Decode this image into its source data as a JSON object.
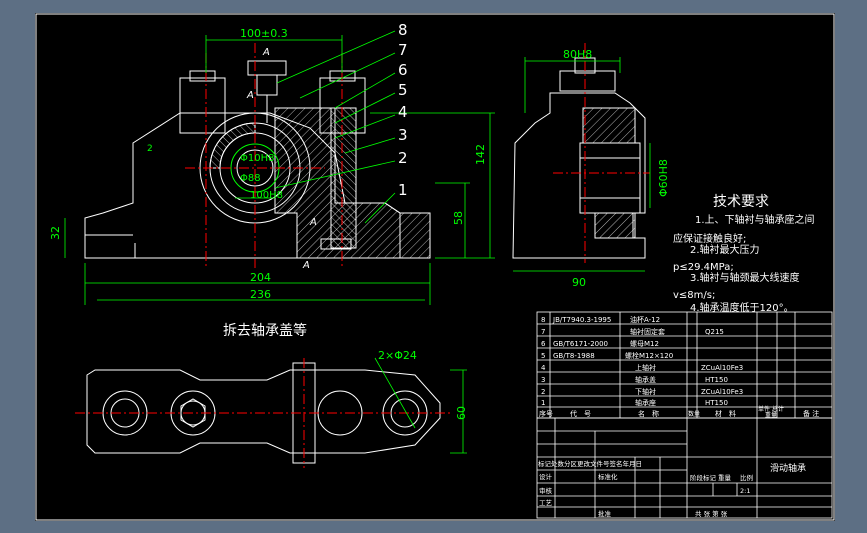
{
  "drawing": {
    "top_dimension": "100±0.3",
    "section_marks": [
      "A",
      "A",
      "A",
      "A"
    ],
    "part_callouts": [
      "8",
      "7",
      "6",
      "5",
      "4",
      "3",
      "2",
      "1"
    ],
    "front_dims": {
      "left_height": "32",
      "mid_height": "58",
      "total_height": "142",
      "inner_width": "204",
      "total_width": "236",
      "clearance": "2",
      "shaft_dia": "Φ10H8",
      "bore_dia": "Φ88",
      "bore_width": "100H8"
    },
    "side_dims": {
      "top_width": "80H8",
      "bottom_width": "90",
      "dia": "Φ60H8"
    },
    "plan_view": {
      "title": "拆去轴承盖等",
      "holes": "2×Φ24",
      "height": "60"
    }
  },
  "tech_requirements": {
    "title": "技术要求",
    "lines": [
      "1.上、下轴衬与轴承座之间",
      "应保证接触良好;",
      "2.轴衬最大压力",
      "p≤29.4MPa;",
      "3.轴衬与轴颈最大线速度",
      "v≤8m/s;",
      "4.轴承温度低于120°。"
    ]
  },
  "parts_list": {
    "rows": [
      {
        "no": "8",
        "code": "JB/T7940.3-1995",
        "name": "油杯A-12",
        "qty": "",
        "material": ""
      },
      {
        "no": "7",
        "code": "",
        "name": "轴衬固定套",
        "qty": "",
        "material": "Q215"
      },
      {
        "no": "6",
        "code": "GB/T6171-2000",
        "name": "螺母M12",
        "qty": "",
        "material": ""
      },
      {
        "no": "5",
        "code": "GB/T8-1988",
        "name": "螺栓M12×120",
        "qty": "",
        "material": ""
      },
      {
        "no": "4",
        "code": "",
        "name": "上轴衬",
        "qty": "",
        "material": "ZCuAl10Fe3"
      },
      {
        "no": "3",
        "code": "",
        "name": "轴承盖",
        "qty": "",
        "material": "HT150"
      },
      {
        "no": "2",
        "code": "",
        "name": "下轴衬",
        "qty": "",
        "material": "ZCuAl10Fe3"
      },
      {
        "no": "1",
        "code": "",
        "name": "轴承座",
        "qty": "",
        "material": "HT150"
      }
    ],
    "header": {
      "no": "序号",
      "code": "代　号",
      "name": "名　称",
      "qty": "数量",
      "material": "材　料",
      "single_total": "单件 总计",
      "weight": "重量",
      "remarks": "备 注"
    }
  },
  "title_block": {
    "drawing_name": "滑动轴承",
    "revision_row": "标记处数分区更改文件号签名年月日",
    "design": "设计",
    "standard": "标准化",
    "stage": "阶段标记",
    "weight": "重量",
    "scale": "比例",
    "scale_value": "2:1",
    "review": "审核",
    "process": "工艺",
    "approve": "批准",
    "sheets": "共 张 第 张"
  }
}
